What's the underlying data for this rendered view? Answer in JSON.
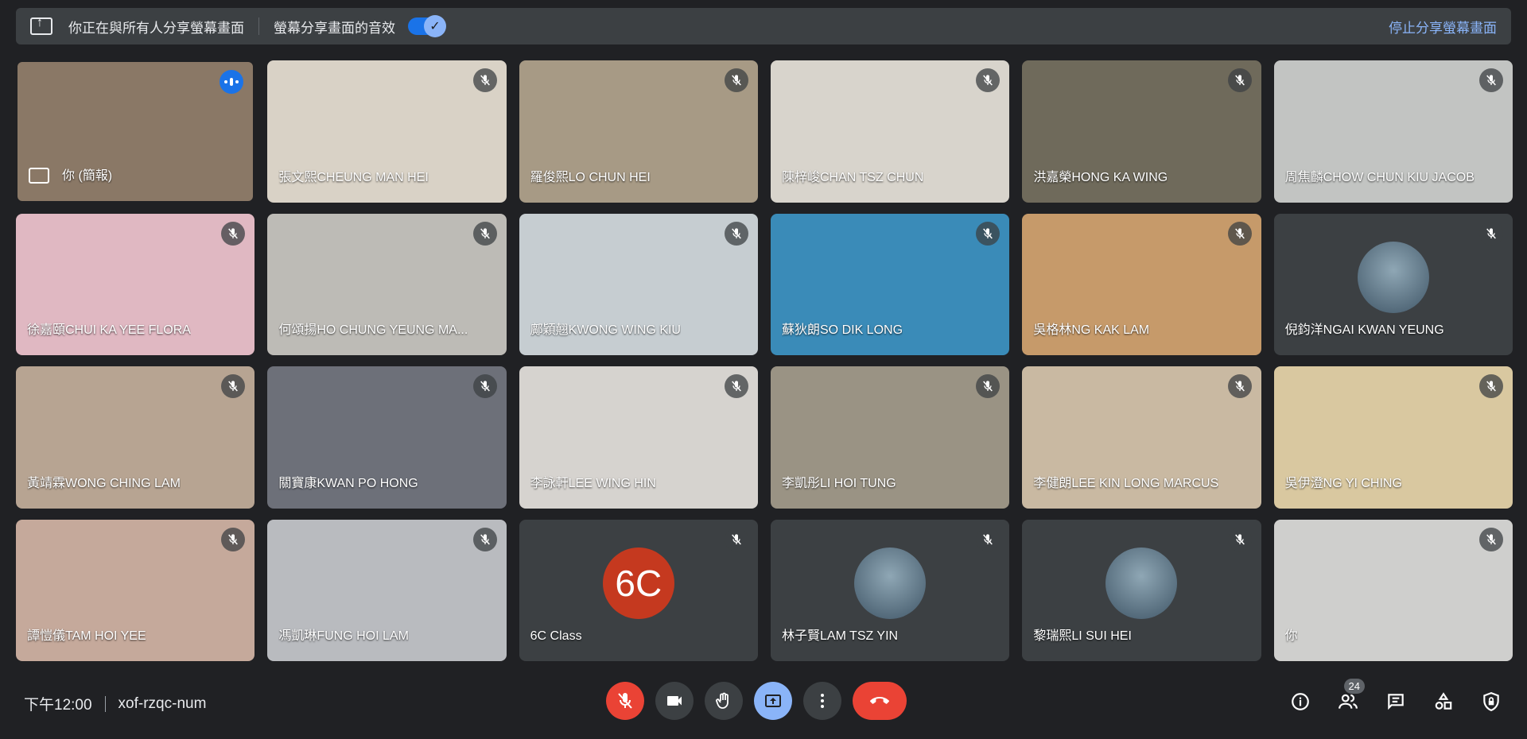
{
  "banner": {
    "sharing_text": "你正在與所有人分享螢幕畫面",
    "audio_text": "螢幕分享畫面的音效",
    "stop_label": "停止分享螢幕畫面"
  },
  "participants": [
    {
      "name": "你 (簡報)",
      "muted": false,
      "speaking": true,
      "self": true,
      "bg": "#8a7866"
    },
    {
      "name": "張文熙CHEUNG MAN HEI",
      "muted": true,
      "bg": "#d9d2c6"
    },
    {
      "name": "羅俊熙LO CHUN HEI",
      "muted": true,
      "bg": "#a79a85"
    },
    {
      "name": "陳梓峻CHAN TSZ CHUN",
      "muted": true,
      "bg": "#d8d4cc"
    },
    {
      "name": "洪嘉榮HONG KA WING",
      "muted": true,
      "bg": "#6f6a5b"
    },
    {
      "name": "周焦麟CHOW CHUN KIU JACOB",
      "muted": true,
      "bg": "#c2c4c2"
    },
    {
      "name": "徐嘉頤CHUI KA YEE FLORA",
      "muted": true,
      "bg": "#e0b8c2"
    },
    {
      "name": "何頌揚HO CHUNG YEUNG MA...",
      "muted": true,
      "bg": "#bdbbb6"
    },
    {
      "name": "鄺穎翹KWONG WING KIU",
      "muted": true,
      "bg": "#c6cdd1"
    },
    {
      "name": "蘇狄朗SO DIK LONG",
      "muted": true,
      "bg": "#3a8bb8"
    },
    {
      "name": "吳格林NG KAK LAM",
      "muted": true,
      "bg": "#c69a6a"
    },
    {
      "name": "倪鈞洋NGAI KWAN YEUNG",
      "muted": true,
      "avatar": "photo",
      "bg": "#3c4043"
    },
    {
      "name": "黃靖霖WONG CHING LAM",
      "muted": true,
      "bg": "#b7a492"
    },
    {
      "name": "關寶康KWAN PO HONG",
      "muted": true,
      "bg": "#6d7079"
    },
    {
      "name": "李詠軒LEE WING HIN",
      "muted": true,
      "bg": "#d6d3cf"
    },
    {
      "name": "李凱彤LI HOI TUNG",
      "muted": true,
      "bg": "#9a9384"
    },
    {
      "name": "李健朗LEE KIN LONG MARCUS",
      "muted": true,
      "bg": "#c9b9a2"
    },
    {
      "name": "吳伊澄NG YI CHING",
      "muted": true,
      "bg": "#d9c8a0"
    },
    {
      "name": "譚愷儀TAM HOI YEE",
      "muted": true,
      "bg": "#c5a99b"
    },
    {
      "name": "馮凱琳FUNG HOI LAM",
      "muted": true,
      "bg": "#b9bbbf"
    },
    {
      "name": "6C Class",
      "muted": true,
      "avatar": "letters",
      "avatar_text": "6C",
      "bg": "#3c4043"
    },
    {
      "name": "林子賢LAM TSZ YIN",
      "muted": true,
      "avatar": "photo",
      "bg": "#3c4043"
    },
    {
      "name": "黎瑞熙LI SUI HEI",
      "muted": true,
      "avatar": "photo",
      "bg": "#3c4043"
    },
    {
      "name": "你",
      "muted": true,
      "bg": "#cfcfcd"
    }
  ],
  "bottom": {
    "time": "下午12:00",
    "meeting_code": "xof-rzqc-num",
    "participant_count": "24"
  },
  "colors": {
    "accent_blue": "#8ab4f8",
    "danger_red": "#ea4335",
    "surface": "#3c4043",
    "background": "#202124"
  }
}
